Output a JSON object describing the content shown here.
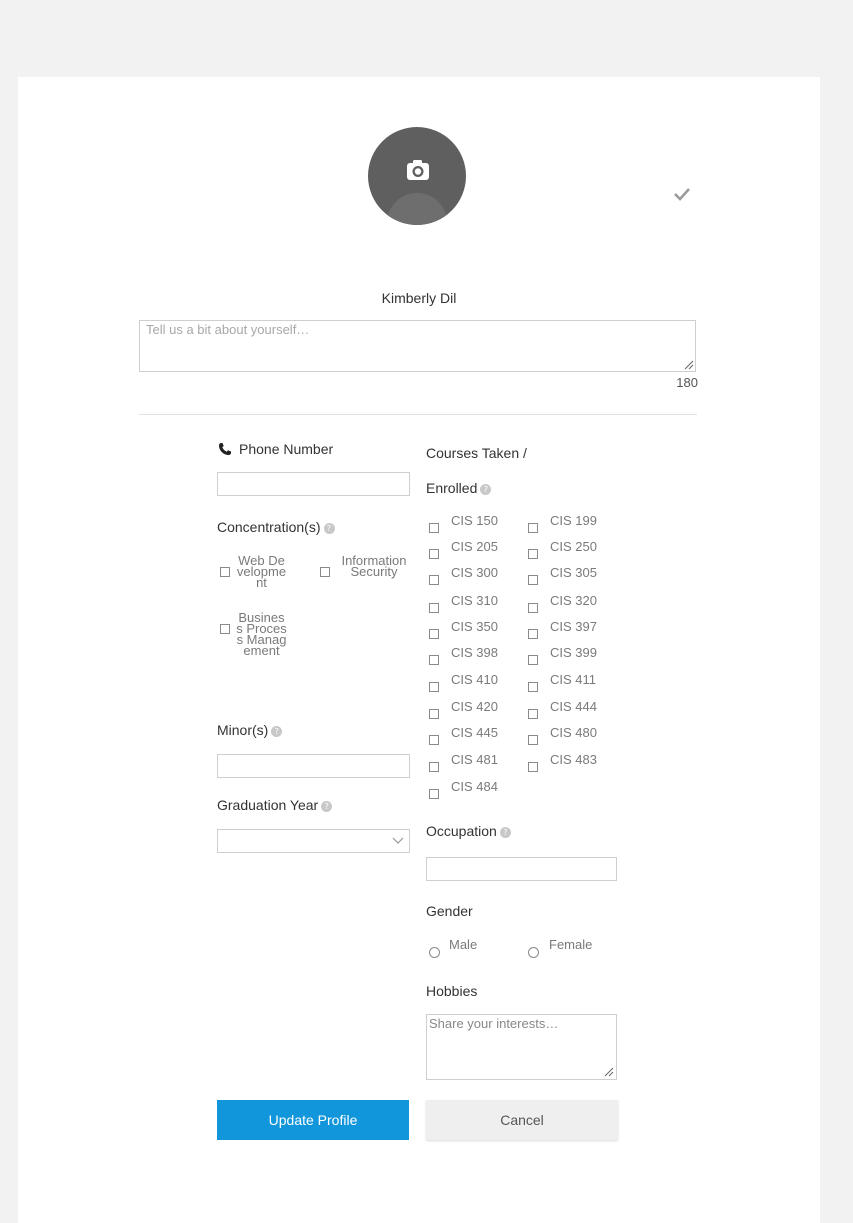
{
  "profile": {
    "name": "Kimberly Dil",
    "bio_placeholder": "Tell us a bit about yourself…",
    "bio_char_count": "180",
    "avatar_icon": "camera-icon",
    "confirm_icon": "checkmark-icon"
  },
  "left_column": {
    "phone": {
      "label": "Phone Number",
      "icon": "phone-icon",
      "value": ""
    },
    "concentrations": {
      "label": "Concentration(s)",
      "options": [
        {
          "label": "Web Development",
          "checked": false
        },
        {
          "label": "Information Security",
          "checked": false
        },
        {
          "label": "Business Process Management",
          "checked": false
        }
      ]
    },
    "minors": {
      "label": "Minor(s)",
      "value": ""
    },
    "graduation_year": {
      "label": "Graduation Year",
      "selected": ""
    }
  },
  "right_column": {
    "courses": {
      "label_line1": "Courses Taken /",
      "label_line2": "Enrolled",
      "items": [
        "CIS 150",
        "CIS 199",
        "CIS 205",
        "CIS 250",
        "CIS 300",
        "CIS 305",
        "CIS 310",
        "CIS 320",
        "CIS 350",
        "CIS 397",
        "CIS 398",
        "CIS 399",
        "CIS 410",
        "CIS 411",
        "CIS 420",
        "CIS 444",
        "CIS 445",
        "CIS 480",
        "CIS 481",
        "CIS 483",
        "CIS 484"
      ]
    },
    "occupation": {
      "label": "Occupation",
      "value": ""
    },
    "gender": {
      "label": "Gender",
      "options": [
        "Male",
        "Female"
      ]
    },
    "hobbies": {
      "label": "Hobbies",
      "placeholder": "Share your interests…"
    }
  },
  "actions": {
    "update_label": "Update Profile",
    "cancel_label": "Cancel"
  },
  "colors": {
    "primary": "#1296db",
    "page_background": "#f2f2f2",
    "avatar": "#5f5f5f"
  }
}
